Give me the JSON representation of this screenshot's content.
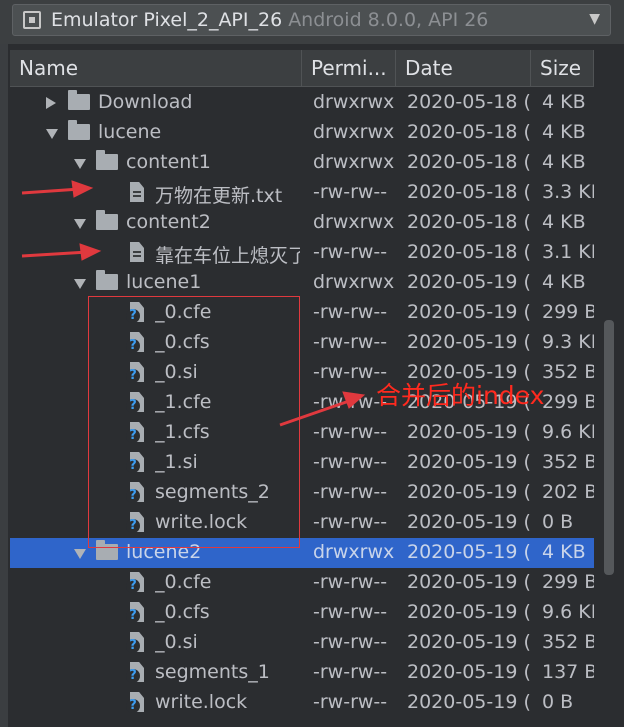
{
  "device": {
    "name": "Emulator Pixel_2_API_26",
    "version": "Android 8.0.0, API 26",
    "phone_icon": "phone-icon",
    "chevron_icon": "chevron-down-icon"
  },
  "columns": {
    "name": "Name",
    "perm": "Permi...",
    "date": "Date",
    "size": "Size"
  },
  "rows": [
    {
      "name": "Download",
      "type": "folder",
      "state": "collapsed",
      "depth": 1,
      "perm": "drwxrwx",
      "date": "2020-05-18 (",
      "size": "4 KB"
    },
    {
      "name": "lucene",
      "type": "folder",
      "state": "expanded",
      "depth": 1,
      "perm": "drwxrwx",
      "date": "2020-05-18 (",
      "size": "4 KB"
    },
    {
      "name": "content1",
      "type": "folder",
      "state": "expanded",
      "depth": 2,
      "perm": "drwxrwx",
      "date": "2020-05-18 (",
      "size": "4 KB"
    },
    {
      "name": "万物在更新.txt",
      "type": "file",
      "depth": 3,
      "perm": "-rw-rw--",
      "date": "2020-05-18 (",
      "size": "3.3 KI"
    },
    {
      "name": "content2",
      "type": "folder",
      "state": "expanded",
      "depth": 2,
      "perm": "drwxrwx",
      "date": "2020-05-18 (",
      "size": "4 KB"
    },
    {
      "name": "靠在车位上熄灭了",
      "type": "file",
      "depth": 3,
      "perm": "-rw-rw--",
      "date": "2020-05-18 (",
      "size": "3.1 KI"
    },
    {
      "name": "lucene1",
      "type": "folder",
      "state": "expanded",
      "depth": 2,
      "perm": "drwxrwx",
      "date": "2020-05-19 (",
      "size": "4 KB"
    },
    {
      "name": "_0.cfe",
      "type": "unknown",
      "depth": 3,
      "perm": "-rw-rw--",
      "date": "2020-05-19 (",
      "size": "299 B"
    },
    {
      "name": "_0.cfs",
      "type": "unknown",
      "depth": 3,
      "perm": "-rw-rw--",
      "date": "2020-05-19 (",
      "size": "9.3 KI"
    },
    {
      "name": "_0.si",
      "type": "unknown",
      "depth": 3,
      "perm": "-rw-rw--",
      "date": "2020-05-19 (",
      "size": "352 B"
    },
    {
      "name": "_1.cfe",
      "type": "unknown",
      "depth": 3,
      "perm": "-rw-rw--",
      "date": "2020-05-19 (",
      "size": "299 B"
    },
    {
      "name": "_1.cfs",
      "type": "unknown",
      "depth": 3,
      "perm": "-rw-rw--",
      "date": "2020-05-19 (",
      "size": "9.6 KI"
    },
    {
      "name": "_1.si",
      "type": "unknown",
      "depth": 3,
      "perm": "-rw-rw--",
      "date": "2020-05-19 (",
      "size": "352 B"
    },
    {
      "name": "segments_2",
      "type": "unknown",
      "depth": 3,
      "perm": "-rw-rw--",
      "date": "2020-05-19 (",
      "size": "202 B"
    },
    {
      "name": "write.lock",
      "type": "unknown",
      "depth": 3,
      "perm": "-rw-rw--",
      "date": "2020-05-19 (",
      "size": "0 B"
    },
    {
      "name": "lucene2",
      "type": "folder",
      "state": "expanded",
      "depth": 2,
      "perm": "drwxrwx",
      "date": "2020-05-19 (",
      "size": "4 KB",
      "selected": true
    },
    {
      "name": "_0.cfe",
      "type": "unknown",
      "depth": 3,
      "perm": "-rw-rw--",
      "date": "2020-05-19 (",
      "size": "299 B"
    },
    {
      "name": "_0.cfs",
      "type": "unknown",
      "depth": 3,
      "perm": "-rw-rw--",
      "date": "2020-05-19 (",
      "size": "9.6 KI"
    },
    {
      "name": "_0.si",
      "type": "unknown",
      "depth": 3,
      "perm": "-rw-rw--",
      "date": "2020-05-19 (",
      "size": "352 B"
    },
    {
      "name": "segments_1",
      "type": "unknown",
      "depth": 3,
      "perm": "-rw-rw--",
      "date": "2020-05-19 (",
      "size": "137 B"
    },
    {
      "name": "write.lock",
      "type": "unknown",
      "depth": 3,
      "perm": "-rw-rw--",
      "date": "2020-05-19 (",
      "size": "0 B"
    }
  ],
  "annotation": {
    "text": "合并后的index",
    "color": "#ff2a1f"
  },
  "colors": {
    "selection": "#2f65ca",
    "background": "#2b2d30",
    "annotation_red": "#e0393e"
  }
}
